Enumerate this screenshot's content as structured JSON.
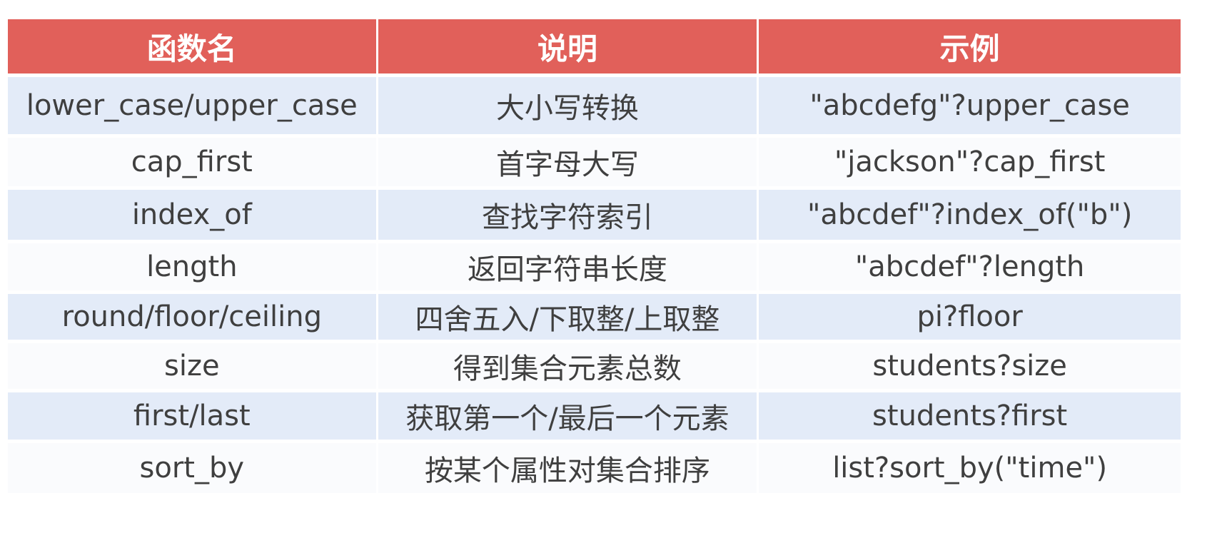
{
  "colors": {
    "header_bg": "#e1605a",
    "header_text": "#ffffff",
    "row_tint": "#e3ebf8",
    "row_plain": "#fafbfd",
    "body_text": "#3f3f3f"
  },
  "table": {
    "headers": [
      "函数名",
      "说明",
      "示例"
    ],
    "rows": [
      {
        "name": "lower_case/upper_case",
        "desc": "大小写转换",
        "example": "\"abcdefg\"?upper_case"
      },
      {
        "name": "cap_first",
        "desc": "首字母大写",
        "example": "\"jackson\"?cap_first"
      },
      {
        "name": "index_of",
        "desc": "查找字符索引",
        "example": "\"abcdef\"?index_of(\"b\")"
      },
      {
        "name": "length",
        "desc": "返回字符串长度",
        "example": "\"abcdef\"?length"
      },
      {
        "name": "round/floor/ceiling",
        "desc": "四舍五入/下取整/上取整",
        "example": "pi?floor"
      },
      {
        "name": "size",
        "desc": "得到集合元素总数",
        "example": "students?size"
      },
      {
        "name": "first/last",
        "desc": "获取第一个/最后一个元素",
        "example": "students?first"
      },
      {
        "name": "sort_by",
        "desc": "按某个属性对集合排序",
        "example": "list?sort_by(\"time\")"
      }
    ]
  }
}
